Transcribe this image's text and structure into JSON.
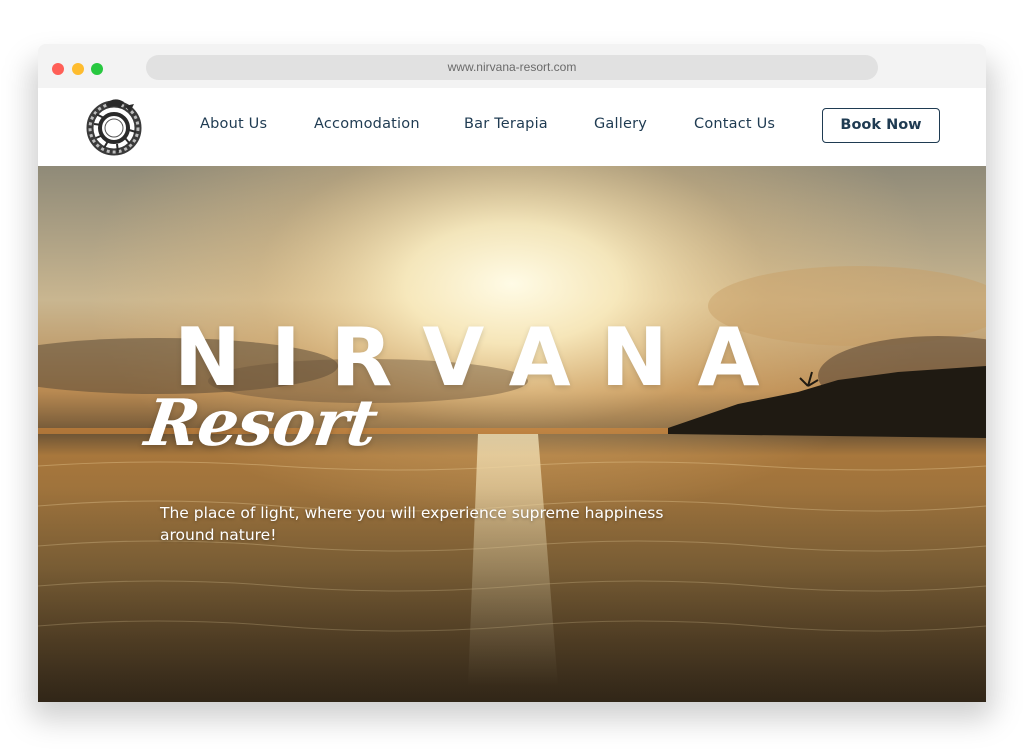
{
  "browser": {
    "url": "www.nirvana-resort.com"
  },
  "header": {
    "logo_icon": "ouroboros-logo-icon",
    "nav_items": [
      {
        "label": "About Us"
      },
      {
        "label": "Accomodation"
      },
      {
        "label": "Bar Terapia"
      },
      {
        "label": "Gallery"
      },
      {
        "label": "Contact Us"
      }
    ],
    "cta_label": "Book Now"
  },
  "hero": {
    "title": "NIRVANA",
    "subtitle_script": "Resort",
    "tagline": "The place of light, where you will experience supreme happiness around nature!"
  },
  "colors": {
    "nav_text": "#1f3b52",
    "hero_text": "#ffffff",
    "sky_top": "#8a8572",
    "sun_glow": "#fff6d8",
    "sea": "#8a6a3c"
  }
}
